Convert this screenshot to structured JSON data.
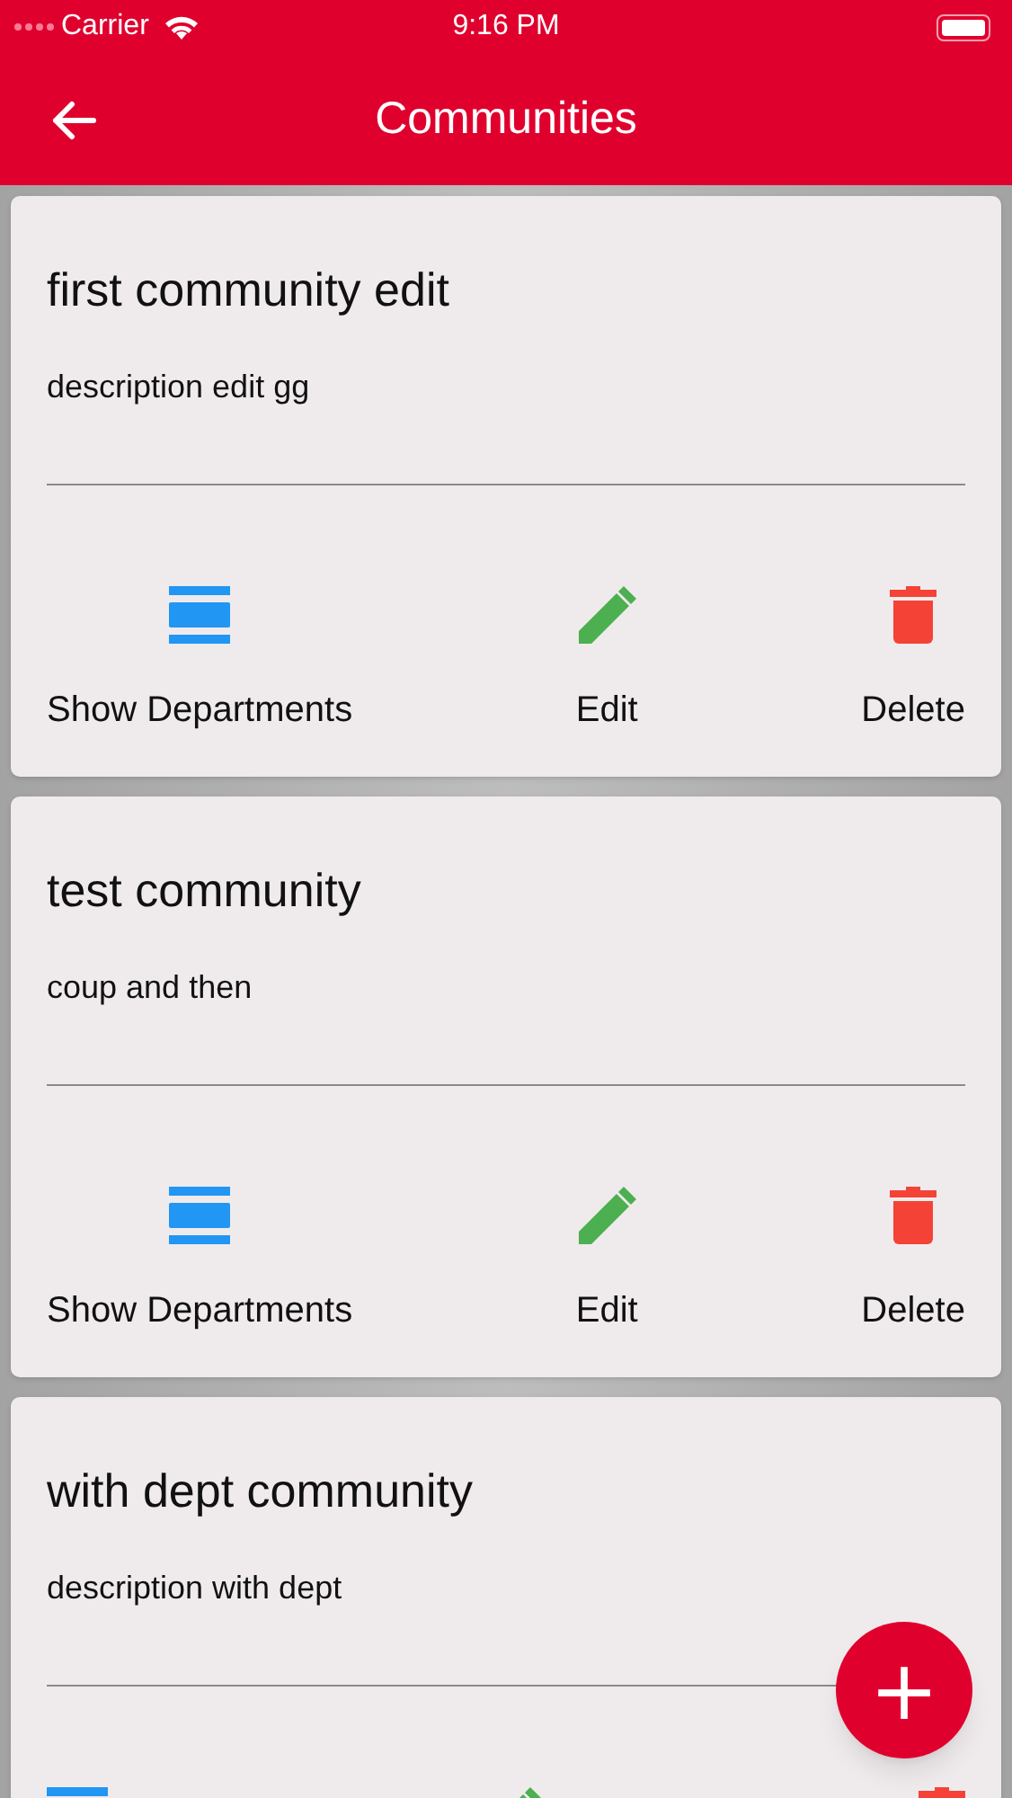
{
  "status_bar": {
    "carrier": "Carrier",
    "time": "9:16 PM"
  },
  "nav": {
    "title": "Communities"
  },
  "communities": [
    {
      "title": "first community edit",
      "description": "description edit gg",
      "actions": [
        {
          "kind": "departments",
          "label": "Show Departments"
        },
        {
          "kind": "edit",
          "label": "Edit"
        },
        {
          "kind": "delete",
          "label": "Delete"
        }
      ]
    },
    {
      "title": "test community",
      "description": "coup and then",
      "actions": [
        {
          "kind": "departments",
          "label": "Show Departments"
        },
        {
          "kind": "edit",
          "label": "Edit"
        },
        {
          "kind": "delete",
          "label": "Delete"
        }
      ]
    },
    {
      "title": "with dept community",
      "description": "description with dept",
      "actions": [
        {
          "kind": "departments"
        },
        {
          "kind": "edit"
        },
        {
          "kind": "delete"
        }
      ]
    }
  ],
  "fab": {
    "label": "+"
  }
}
